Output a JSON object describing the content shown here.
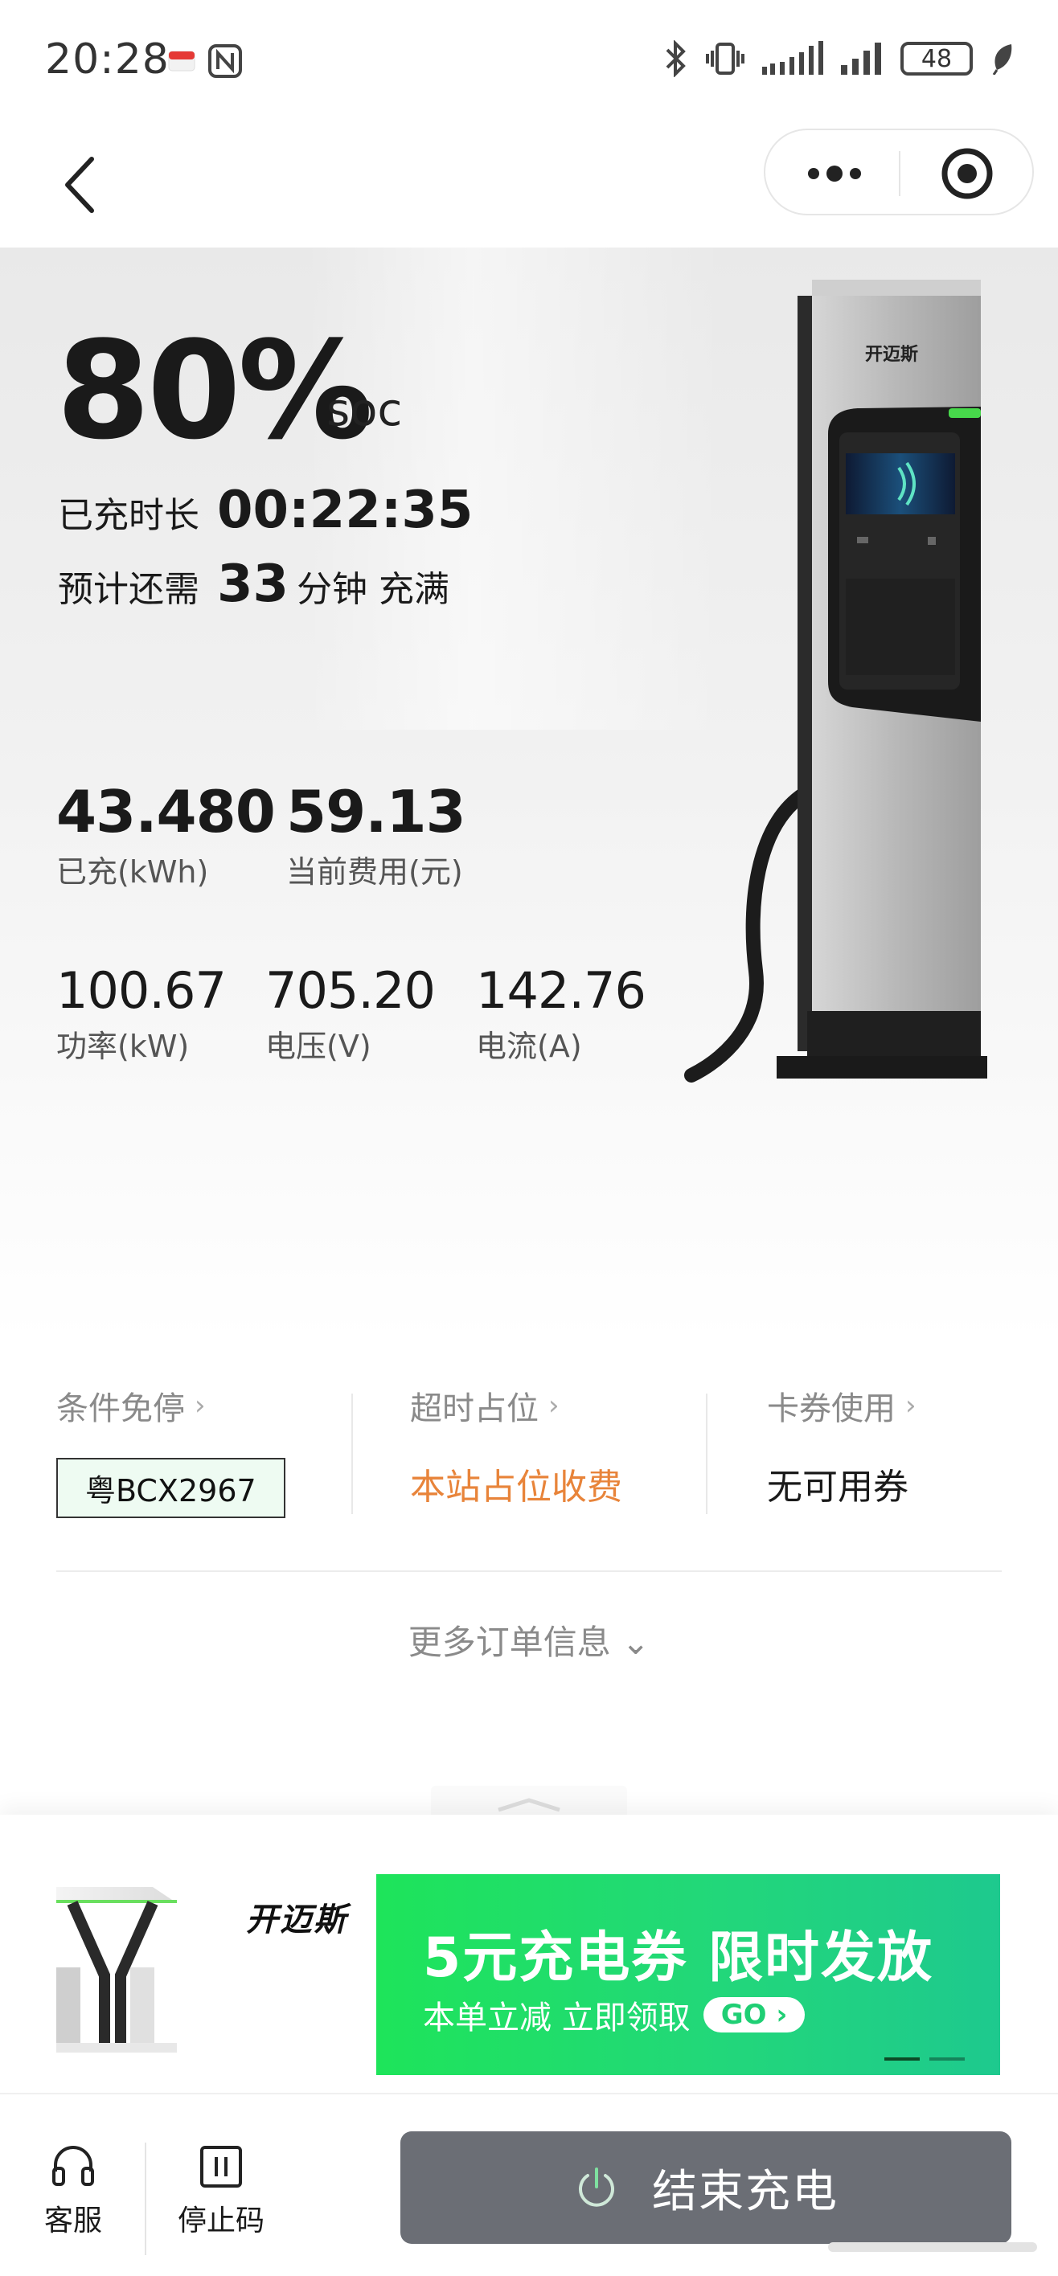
{
  "status_bar": {
    "time": "20:28",
    "battery": "48",
    "icons": [
      "calendar-notification-icon",
      "nfc-icon",
      "bluetooth-icon",
      "vibrate-icon",
      "signal-icon",
      "signal-icon",
      "battery-icon",
      "eco-leaf-icon"
    ]
  },
  "header": {
    "icons": [
      "back-arrow-icon",
      "more-dots-icon",
      "close-target-icon"
    ]
  },
  "hero": {
    "soc_value": "80%",
    "soc_unit": "soc",
    "elapsed_label": "已充时长",
    "elapsed_value": "00:22:35",
    "remaining_prefix": "预计还需",
    "remaining_value": "33",
    "remaining_suffix": "分钟 充满",
    "charged_value": "43.480",
    "charged_label": "已充(kWh)",
    "fee_value": "59.13",
    "fee_label": "当前费用(元)",
    "power_value": "100.67",
    "power_label": "功率(kW)",
    "voltage_value": "705.20",
    "voltage_label": "电压(V)",
    "current_value": "142.76",
    "current_label": "电流(A)",
    "charger_brand": "开迈斯"
  },
  "info": {
    "parking_title": "条件免停",
    "parking_plate": "粤BCX2967",
    "occupancy_title": "超时占位",
    "occupancy_value": "本站占位收费",
    "coupon_title": "卡券使用",
    "coupon_value": "无可用券",
    "chevron": "›",
    "more_info": "更多订单信息 ⌄"
  },
  "banner": {
    "brand": "开迈斯",
    "title": "5元充电券 限时发放",
    "subtitle": "本单立减 立即领取",
    "go": "GO ›"
  },
  "bottom": {
    "service_label": "客服",
    "stop_code_label": "停止码",
    "end_charge_label": "结束充电"
  },
  "colors": {
    "accent_green": "#22d77a",
    "orange": "#e8843a",
    "end_button": "#6b6e75"
  }
}
